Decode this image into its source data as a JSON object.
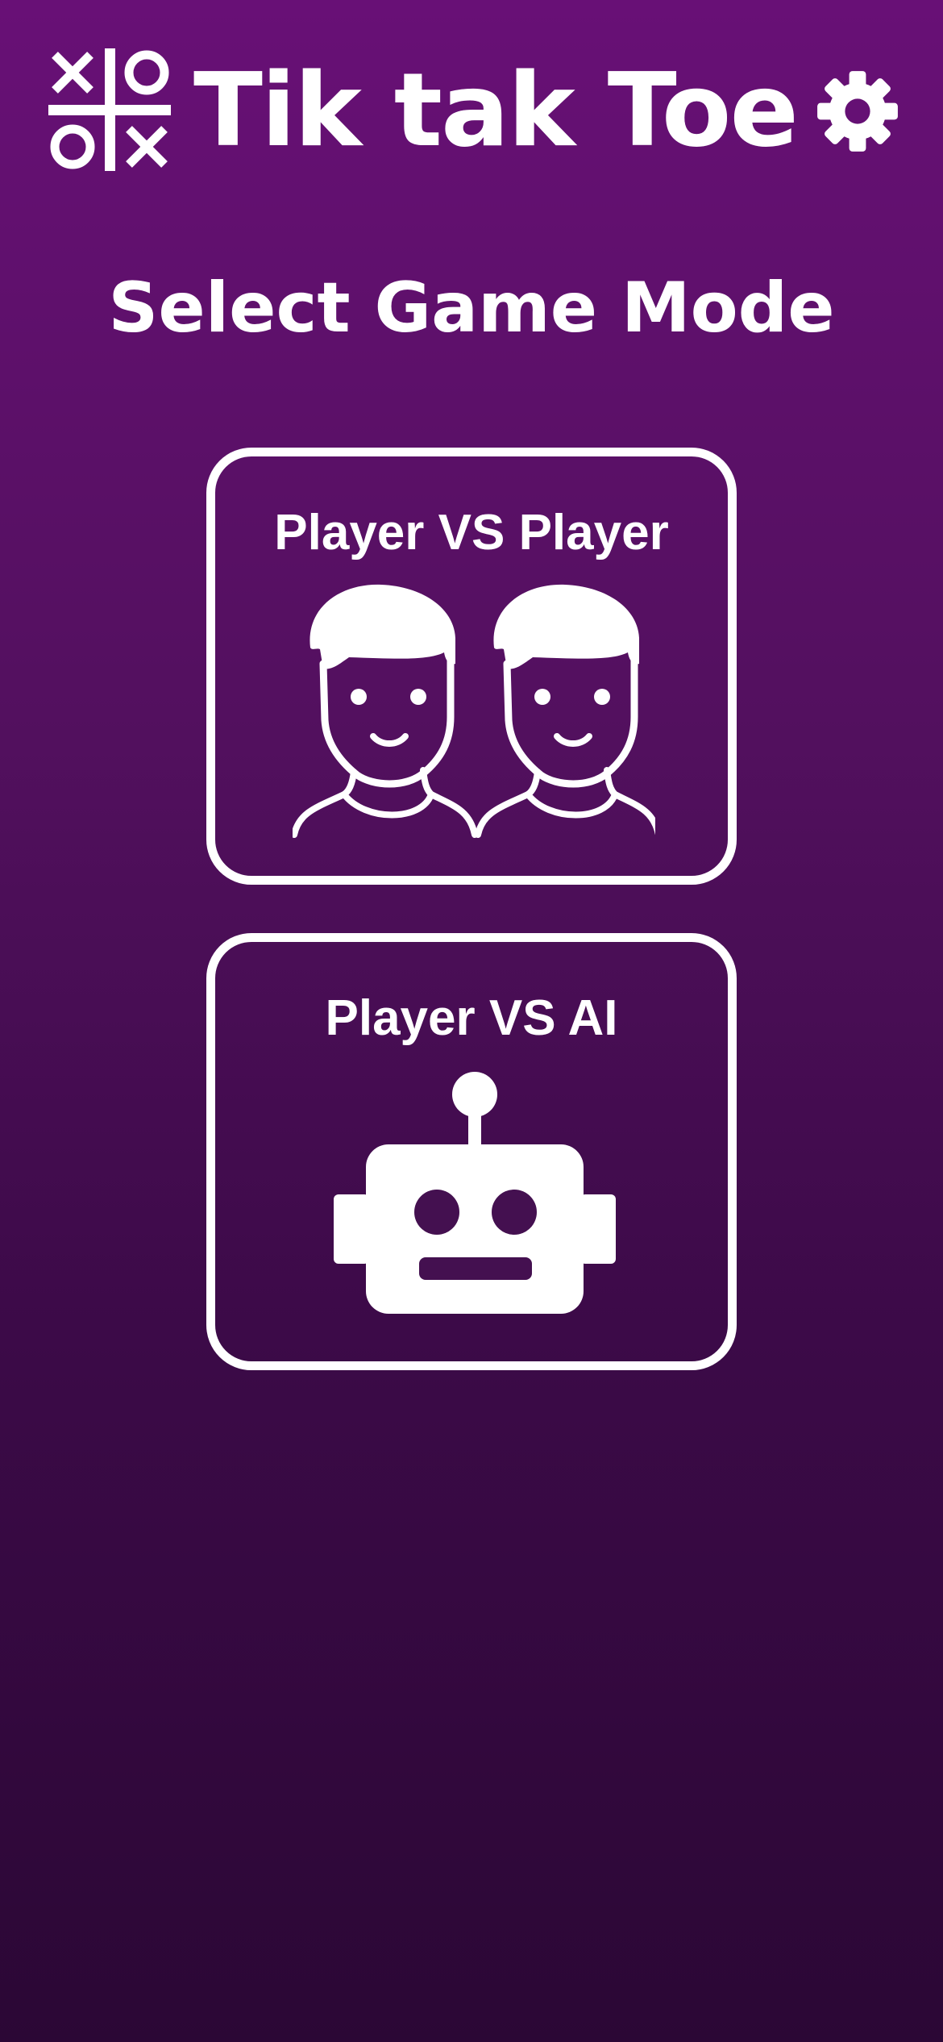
{
  "header": {
    "app_title": "Tik tak Toe",
    "logo_icon": "tic-tac-toe-grid-icon",
    "settings_icon": "gear-icon"
  },
  "main": {
    "heading": "Select Game Mode",
    "modes": [
      {
        "label": "Player VS Player",
        "icon": "two-players-icon"
      },
      {
        "label": "Player VS AI",
        "icon": "robot-icon"
      }
    ]
  },
  "colors": {
    "background_top": "#681076",
    "background_bottom": "#2b0735",
    "foreground": "#ffffff"
  }
}
